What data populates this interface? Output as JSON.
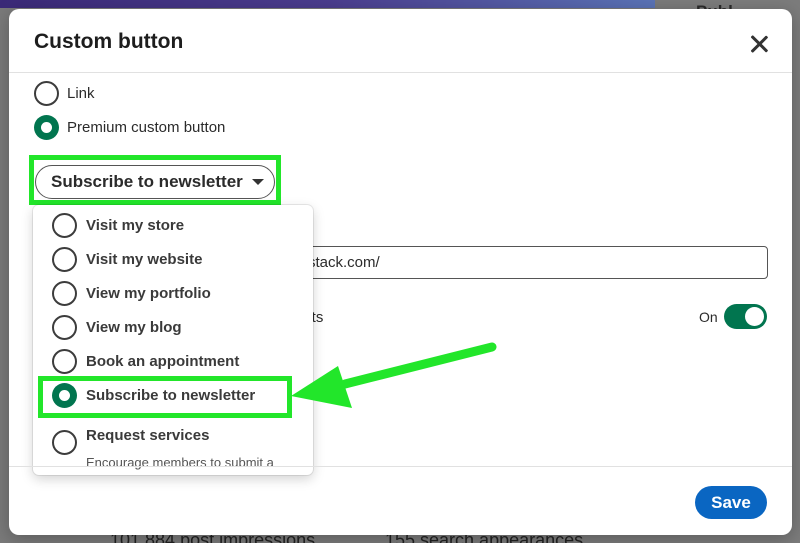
{
  "background": {
    "right_title": "Publ",
    "bottom_stat_1": "101,884 post impressions",
    "bottom_stat_2": "155 search appearances"
  },
  "modal": {
    "title": "Custom button",
    "close_icon": "close-icon",
    "button_type_options": [
      {
        "label": "Link",
        "checked": false
      },
      {
        "label": "Premium custom button",
        "checked": true
      }
    ],
    "dropdown": {
      "selected": "Subscribe to newsletter",
      "options": [
        {
          "label": "Visit my store",
          "checked": false
        },
        {
          "label": "Visit my website",
          "checked": false
        },
        {
          "label": "View my portfolio",
          "checked": false
        },
        {
          "label": "View my blog",
          "checked": false
        },
        {
          "label": "Book an appointment",
          "checked": false
        },
        {
          "label": "Subscribe to newsletter",
          "checked": true
        },
        {
          "label": "Request services",
          "checked": false,
          "description": "Encourage members to submit a"
        }
      ]
    },
    "url_field": {
      "value": "stack.com/"
    },
    "results_label": "ults",
    "toggle": {
      "label": "On",
      "on": true
    },
    "save_label": "Save"
  },
  "colors": {
    "accent_green": "#01754f",
    "save_blue": "#0a66c2",
    "highlight_green": "#22e62a"
  }
}
